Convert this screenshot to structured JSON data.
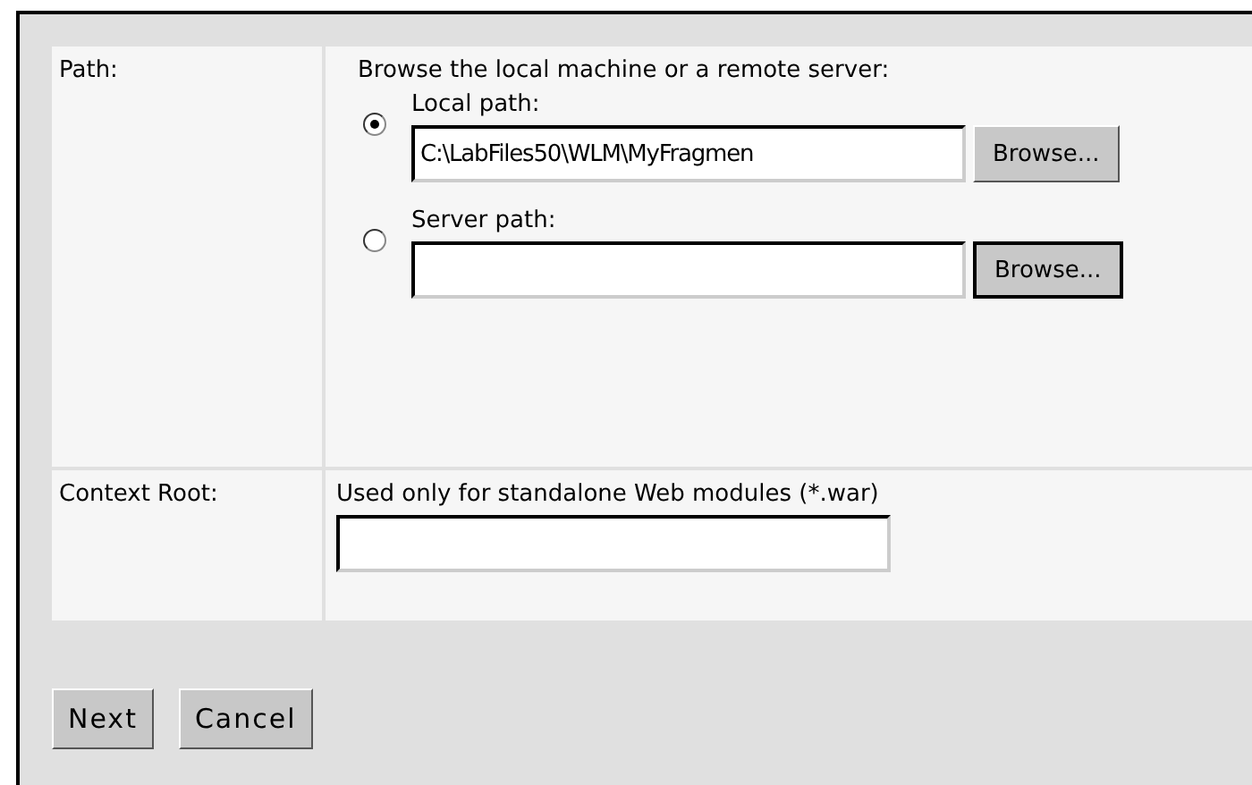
{
  "rows": [
    {
      "label": "Path:",
      "hint": "Browse the local machine or a remote server:",
      "options": [
        {
          "label": "Local path:",
          "selected": true,
          "value": "C:\\LabFiles50\\WLM\\MyFragmen",
          "button": "Browse...",
          "button_pressed": false
        },
        {
          "label": "Server path:",
          "selected": false,
          "button": "Browse...",
          "button_pressed": true
        }
      ]
    },
    {
      "label": "Context Root:",
      "hint": "Used only for standalone Web modules (*.war)",
      "field": true
    }
  ],
  "buttons": [
    "Next",
    "Cancel"
  ]
}
